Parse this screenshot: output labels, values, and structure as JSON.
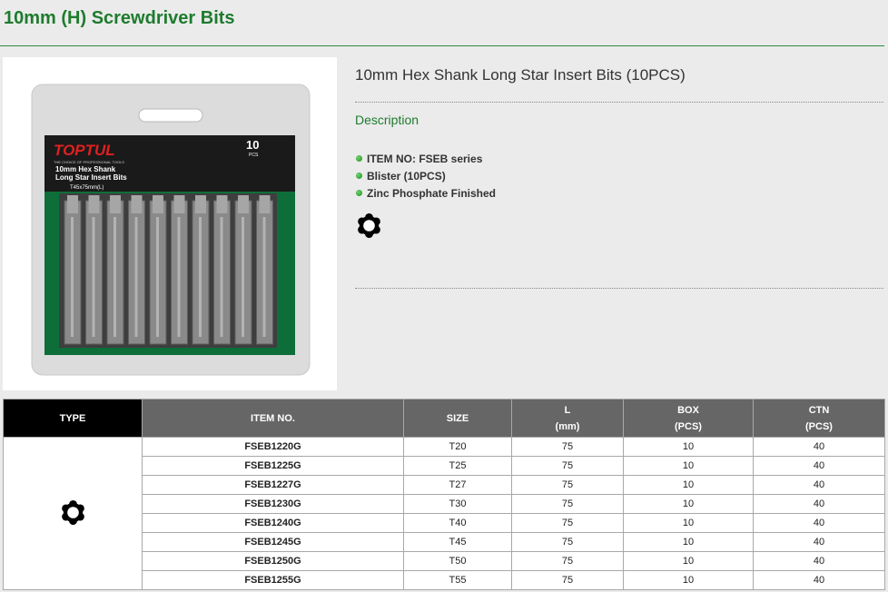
{
  "page": {
    "title": "10mm (H) Screwdriver Bits"
  },
  "product": {
    "title": "10mm Hex Shank Long Star Insert Bits (10PCS)",
    "description_heading": "Description",
    "features": [
      "ITEM NO: FSEB series",
      "Blister (10PCS)",
      "Zinc Phosphate Finished"
    ],
    "card": {
      "brand": "TOPTUL",
      "tagline": "THE CHOICE OF PROFESSIONAL TOOLS",
      "name_line1": "10mm Hex Shank",
      "name_line2": "Long Star Insert Bits",
      "count": "10",
      "count_unit": "PCS",
      "size": "T45x75mm(L)"
    },
    "type_icon": "torx-star-icon"
  },
  "table": {
    "headers": {
      "type": "TYPE",
      "item_no": "ITEM NO.",
      "size": "SIZE",
      "l": "L",
      "l_unit": "(mm)",
      "box": "BOX",
      "box_unit": "(PCS)",
      "ctn": "CTN",
      "ctn_unit": "(PCS)"
    },
    "rows": [
      {
        "item": "FSEB1220G",
        "size": "T20",
        "l": "75",
        "box": "10",
        "ctn": "40"
      },
      {
        "item": "FSEB1225G",
        "size": "T25",
        "l": "75",
        "box": "10",
        "ctn": "40"
      },
      {
        "item": "FSEB1227G",
        "size": "T27",
        "l": "75",
        "box": "10",
        "ctn": "40"
      },
      {
        "item": "FSEB1230G",
        "size": "T30",
        "l": "75",
        "box": "10",
        "ctn": "40"
      },
      {
        "item": "FSEB1240G",
        "size": "T40",
        "l": "75",
        "box": "10",
        "ctn": "40"
      },
      {
        "item": "FSEB1245G",
        "size": "T45",
        "l": "75",
        "box": "10",
        "ctn": "40"
      },
      {
        "item": "FSEB1250G",
        "size": "T50",
        "l": "75",
        "box": "10",
        "ctn": "40"
      },
      {
        "item": "FSEB1255G",
        "size": "T55",
        "l": "75",
        "box": "10",
        "ctn": "40"
      }
    ]
  },
  "colors": {
    "accent_green": "#1e7b2e",
    "header_gray": "#666666",
    "type_header": "#000000"
  }
}
